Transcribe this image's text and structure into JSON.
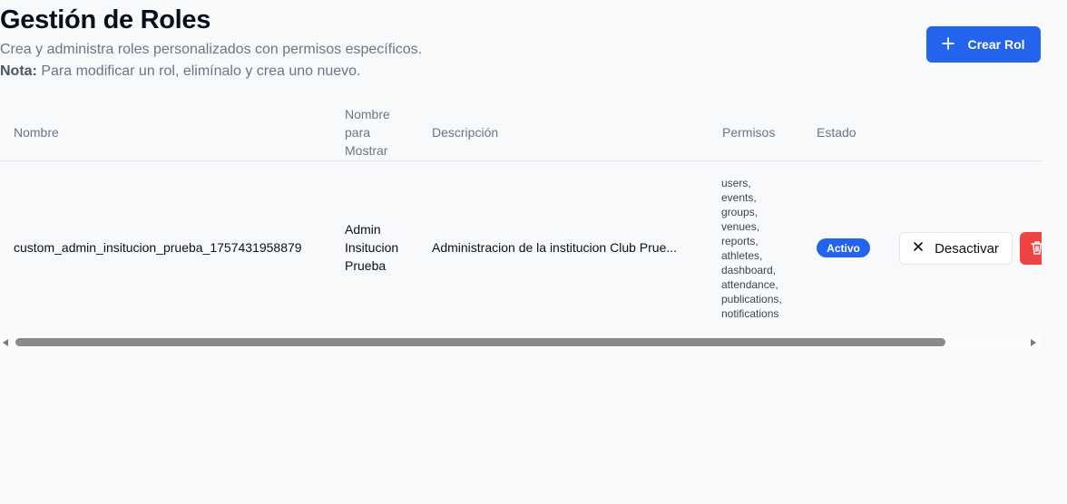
{
  "header": {
    "title": "Gestión de Roles",
    "subtitle": "Crea y administra roles personalizados con permisos específicos.",
    "note_label": "Nota:",
    "note_text": " Para modificar un rol, elimínalo y crea uno nuevo.",
    "create_button_label": "Crear Rol",
    "create_button_icon": "plus-icon"
  },
  "table": {
    "columns": {
      "name": "Nombre",
      "display_name_1": "Nombre",
      "display_name_2": "para",
      "display_name_3": "Mostrar",
      "description": "Descripción",
      "permissions": "Permisos",
      "status": "Estado"
    },
    "rows": [
      {
        "name": "custom_admin_insitucion_prueba_1757431958879",
        "display_name_1": "Admin",
        "display_name_2": "Insitucion",
        "display_name_3": "Prueba",
        "description": "Administracion de la institucion Club Prue...",
        "permissions": [
          "users,",
          "events,",
          "groups,",
          "venues,",
          "reports,",
          "athletes,",
          "dashboard,",
          "attendance,",
          "publications,",
          "notifications"
        ],
        "status": "Activo",
        "deactivate_label": "Desactivar",
        "deactivate_icon": "x-icon",
        "delete_icon": "trash-icon"
      }
    ]
  },
  "colors": {
    "primary": "#2463eb",
    "danger": "#ef4444",
    "muted_text": "#6b7587",
    "background": "#f8f9fb"
  }
}
